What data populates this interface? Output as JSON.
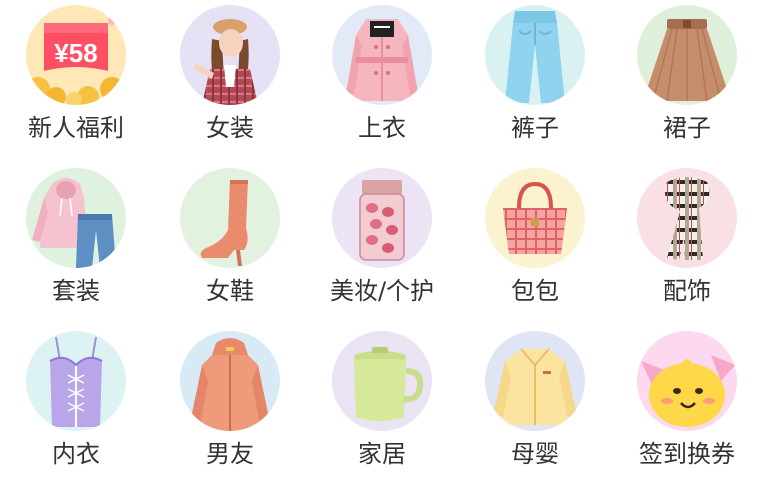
{
  "categories": [
    {
      "label": "新人福利",
      "icon": "coupon-58-icon",
      "bg": "#ffe8b5",
      "badge": "¥58"
    },
    {
      "label": "女装",
      "icon": "woman-model-icon",
      "bg": "#e7e1f5"
    },
    {
      "label": "上衣",
      "icon": "pink-trench-coat-icon",
      "bg": "#e3eaf7"
    },
    {
      "label": "裤子",
      "icon": "blue-pants-icon",
      "bg": "#d9f2f1"
    },
    {
      "label": "裙子",
      "icon": "brown-skirt-icon",
      "bg": "#dff0da"
    },
    {
      "label": "套装",
      "icon": "hoodie-jeans-set-icon",
      "bg": "#dff1df"
    },
    {
      "label": "女鞋",
      "icon": "pink-boot-icon",
      "bg": "#e3f2de"
    },
    {
      "label": "美妆/个护",
      "icon": "serum-bottle-icon",
      "bg": "#ece3f4"
    },
    {
      "label": "包包",
      "icon": "pink-handbag-icon",
      "bg": "#fbf2cf"
    },
    {
      "label": "配饰",
      "icon": "plaid-scarf-icon",
      "bg": "#f9e0e4"
    },
    {
      "label": "内衣",
      "icon": "lace-corset-icon",
      "bg": "#dcf2f3"
    },
    {
      "label": "男友",
      "icon": "orange-jacket-icon",
      "bg": "#d8eaf6"
    },
    {
      "label": "家居",
      "icon": "green-mug-icon",
      "bg": "#e9e3f4"
    },
    {
      "label": "母婴",
      "icon": "yellow-fleece-icon",
      "bg": "#e0e5f6"
    },
    {
      "label": "签到换券",
      "icon": "smiley-mascot-icon",
      "bg": "#fcd9ef"
    }
  ]
}
